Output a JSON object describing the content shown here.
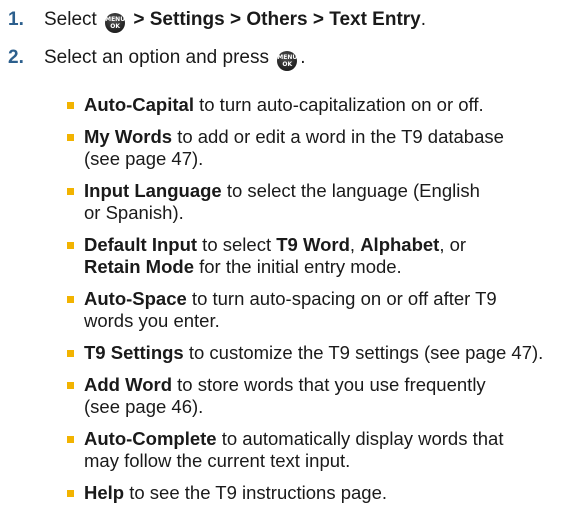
{
  "steps": [
    {
      "number": "1.",
      "prefix": "Select",
      "key_icon": "menu-ok-key",
      "path": "> Settings > Others > Text Entry",
      "suffix": "."
    },
    {
      "number": "2.",
      "prefix": "Select an option and press",
      "key_icon": "menu-ok-key",
      "suffix": "."
    }
  ],
  "key_label_top": "MENU",
  "key_label_bottom": "OK",
  "options": [
    {
      "term": "Auto-Capital",
      "line1": " to turn auto-capitalization on or off.",
      "line2": ""
    },
    {
      "term": "My Words",
      "line1": " to add or edit a word in the T9 database",
      "line2": "(see page 47)."
    },
    {
      "term": "Input Language",
      "line1": " to select the language (English",
      "line2": "or Spanish)."
    },
    {
      "term": "Default Input",
      "line1": " to select ",
      "t9": "T9 Word",
      "sep1": ", ",
      "alpha": "Alphabet",
      "sep2": ", or",
      "retain": "Retain Mode",
      "line2": " for the initial entry mode."
    },
    {
      "term": "Auto-Space",
      "line1": " to turn auto-spacing on or off after T9",
      "line2": "words you enter."
    },
    {
      "term": "T9 Settings",
      "line1": " to customize the T9 settings (see page 47).",
      "line2": ""
    },
    {
      "term": "Add Word",
      "line1": " to store words that you use frequently",
      "line2": "(see page 46)."
    },
    {
      "term": "Auto-Complete",
      "line1": " to automatically display words that",
      "line2": "may follow the current text input."
    },
    {
      "term": "Help",
      "line1": " to see the T9 instructions page.",
      "line2": ""
    }
  ]
}
